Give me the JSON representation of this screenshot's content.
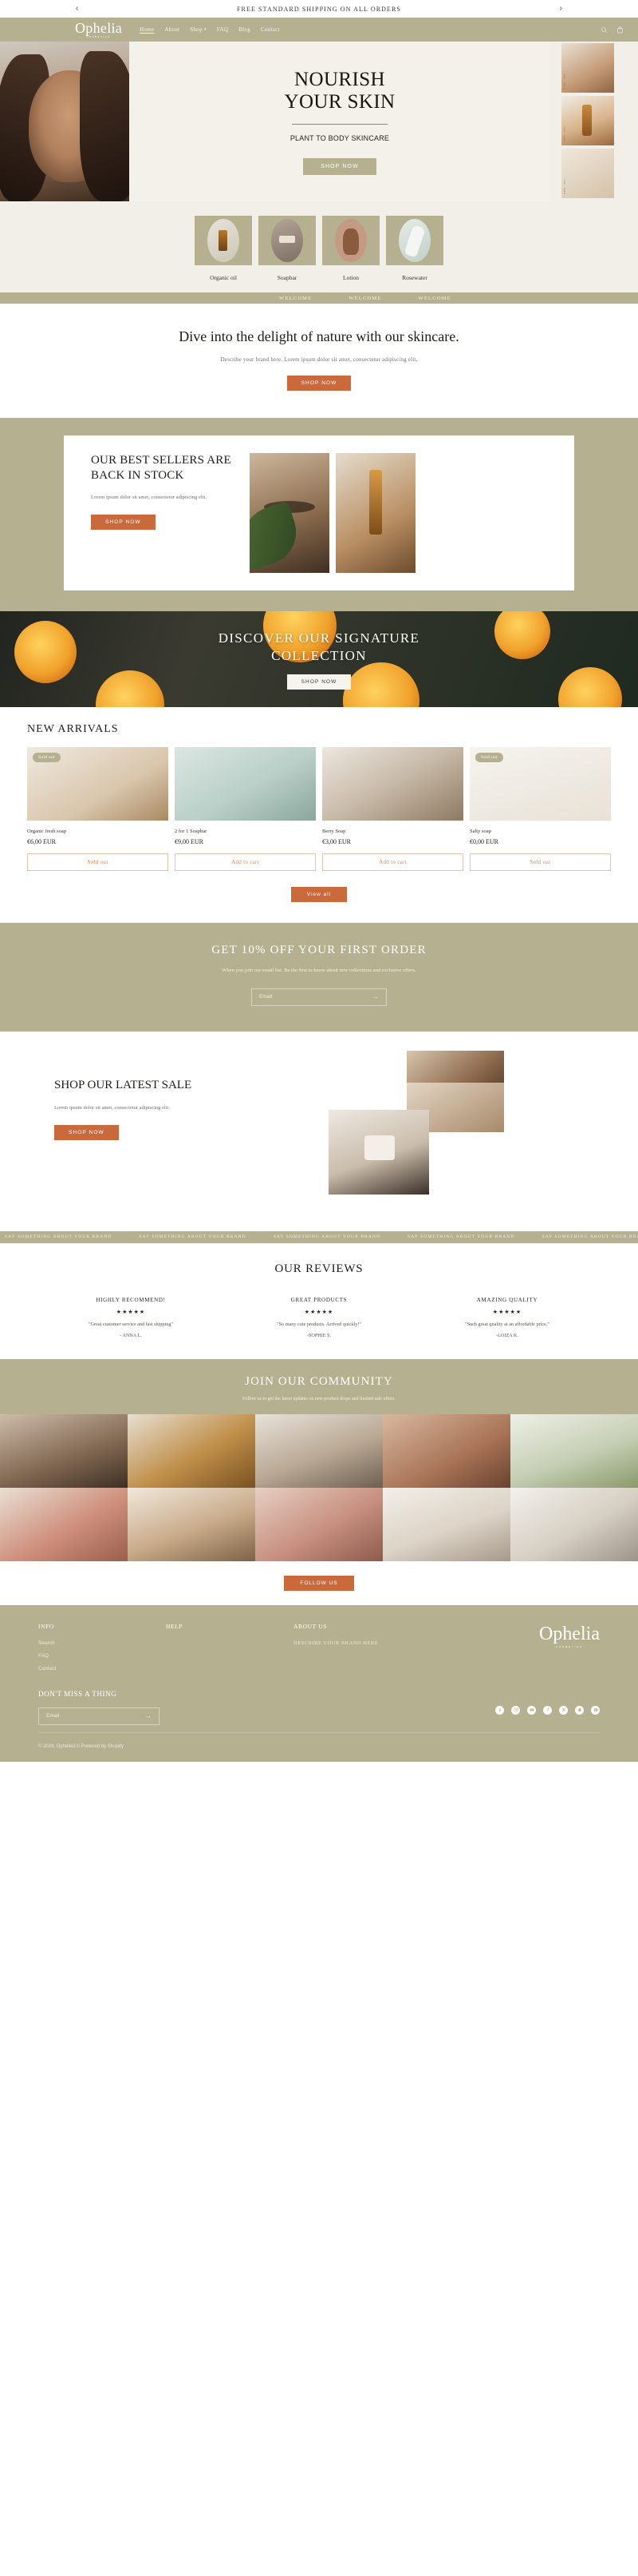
{
  "announcement": {
    "text": "FREE STANDARD SHIPPING ON ALL ORDERS",
    "prev_icon": "chevron-left-icon",
    "next_icon": "chevron-right-icon"
  },
  "header": {
    "logo": "Ophelia",
    "logo_sub": "COSMETICS",
    "nav": [
      {
        "label": "Home",
        "active": true
      },
      {
        "label": "About",
        "active": false
      },
      {
        "label": "Shop",
        "active": false,
        "caret": "∨"
      },
      {
        "label": "FAQ",
        "active": false
      },
      {
        "label": "Blog",
        "active": false
      },
      {
        "label": "Contact",
        "active": false
      }
    ],
    "search_icon": "search-icon",
    "cart_icon": "cart-icon"
  },
  "hero": {
    "title_line1": "NOURISH",
    "title_line2": "YOUR SKIN",
    "subtitle": "PLANT TO BODY SKINCARE",
    "cta": "SHOP NOW",
    "side_labels": [
      "Luxe · Hydra",
      "Luxe · Hydra",
      "Luxe · Hydra"
    ]
  },
  "categories": [
    {
      "label": "Organic oil"
    },
    {
      "label": "Soapbar"
    },
    {
      "label": "Lotion"
    },
    {
      "label": "Rosewater"
    }
  ],
  "welcome_marquee": "WELCOME",
  "welcome": {
    "heading": "Dive into the delight of nature with our skincare.",
    "body": "Describe your brand here. Lorem ipsum dolor sit amet, consectetur adipiscing elit.",
    "cta": "SHOP NOW"
  },
  "bestsellers": {
    "heading": "OUR BEST SELLERS ARE BACK IN STOCK",
    "body": "Lorem ipsum dolor sit amet, consectetur adipiscing elit.",
    "cta": "SHOP NOW"
  },
  "signature": {
    "line1": "DISCOVER OUR SIGNATURE",
    "line2": "COLLECTION",
    "cta": "SHOP NOW"
  },
  "arrivals": {
    "heading": "NEW ARRIVALS",
    "view_all": "View all",
    "products": [
      {
        "name": "Organic fresh soap",
        "price": "€6,00 EUR",
        "button": "Sold out",
        "badge": "Sold out",
        "sold_out": true
      },
      {
        "name": "2 for 1 Soapbar",
        "price": "€9,00 EUR",
        "button": "Add to cart",
        "badge": "",
        "sold_out": false
      },
      {
        "name": "Berry Soap",
        "price": "€3,00 EUR",
        "button": "Add to cart",
        "badge": "",
        "sold_out": false
      },
      {
        "name": "Salty soap",
        "price": "€0,00 EUR",
        "button": "Sold out",
        "badge": "Sold out",
        "sold_out": true
      }
    ]
  },
  "promo": {
    "heading": "GET 10% OFF YOUR FIRST ORDER",
    "body": "When you join our email list. Be the first to know about new collections and exclusive offers.",
    "email_placeholder": "Email",
    "submit_icon": "arrow-right-icon"
  },
  "sale": {
    "heading": "SHOP OUR LATEST SALE",
    "body": "Lorem ipsum dolor sit amet, consectetur adipiscing elit.",
    "cta": "SHOP NOW"
  },
  "brand_marquee": "SAY SOMETHING ABOUT YOUR BRAND",
  "reviews": {
    "heading": "OUR REVIEWS",
    "items": [
      {
        "title": "HIGHLY RECOMMEND!",
        "stars": "★★★★★",
        "text": "\"Great customer service and fast shipping\"",
        "author": "- ANNA L."
      },
      {
        "title": "GREAT PRODUCTS",
        "stars": "★★★★★",
        "text": "\"So many cute products. Arrived quickly!\"",
        "author": "-SOPHIE S."
      },
      {
        "title": "AMAZING QUALITY",
        "stars": "★★★★★",
        "text": "\"Such great quality at an affordable price.\"",
        "author": "-LOIZA K."
      }
    ]
  },
  "community": {
    "heading": "JOIN OUR COMMUNITY",
    "body": "Follow us to get the latest updates on new product drops and limited sale offers.",
    "cta": "FOLLOW US"
  },
  "footer": {
    "columns": [
      {
        "title": "INFO",
        "links": [
          "Search",
          "FAQ",
          "Contact"
        ]
      },
      {
        "title": "HELP",
        "links": []
      },
      {
        "title": "ABOUT US",
        "about_text": "DESCRIBE YOUR BRAND HERE"
      }
    ],
    "logo": "Ophelia",
    "logo_sub": "COSMETICS",
    "newsletter_title": "DON'T MISS A THING",
    "email_placeholder": "Email",
    "submit_icon": "arrow-right-icon",
    "social": [
      "facebook-icon",
      "instagram-icon",
      "youtube-icon",
      "tiktok-icon",
      "twitter-x-icon",
      "snapchat-icon",
      "pinterest-icon"
    ],
    "copyright": "© 2024, Ophelia2.0 Powered by Shopify"
  }
}
